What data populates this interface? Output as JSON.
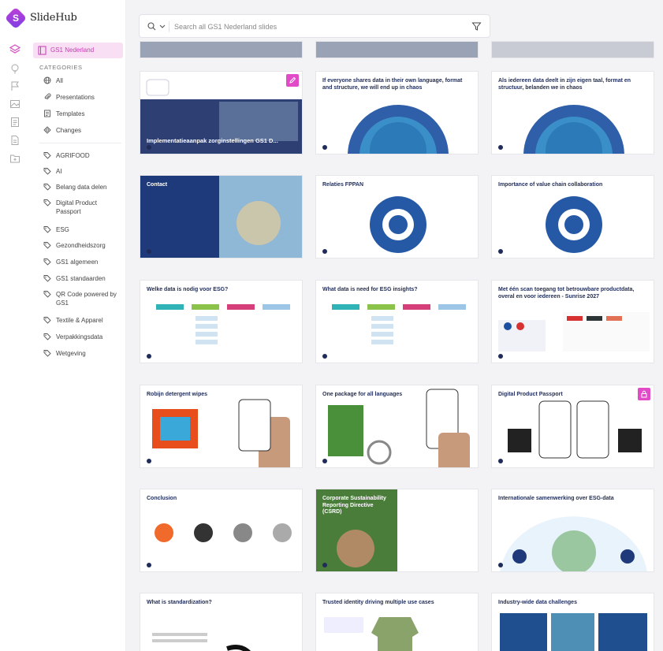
{
  "app": {
    "brand": "SlideHub"
  },
  "rail": {
    "icons": [
      "layers-icon",
      "lightbulb-icon",
      "flag-icon",
      "image-icon",
      "document-icon",
      "file-icon",
      "folder-plus-icon"
    ]
  },
  "sidebar": {
    "active_item": "GS1 Nederland",
    "categories_heading": "CATEGORIES",
    "categories": [
      {
        "label": "All",
        "icon": "globe-icon"
      },
      {
        "label": "Presentations",
        "icon": "paperclip-icon"
      },
      {
        "label": "Templates",
        "icon": "template-icon"
      },
      {
        "label": "Changes",
        "icon": "shapes-icon"
      }
    ],
    "tags": [
      "AGRIFOOD",
      "AI",
      "Belang data delen",
      "Digital Product Passport",
      "ESG",
      "Gezondheidszorg",
      "GS1 algemeen",
      "GS1 standaarden",
      "QR Code powered by GS1",
      "Textile & Apparel",
      "Verpakkingsdata",
      "Wetgeving"
    ]
  },
  "search": {
    "placeholder": "Search all GS1 Nederland slides"
  },
  "slides": [
    {
      "title": "Implementatieaanpak zorginstellingen GS1 D...",
      "badge": "edit-icon"
    },
    {
      "title": "If everyone shares data in their own language, format and structure, we will end up in chaos"
    },
    {
      "title": "Als iedereen data deelt in zijn eigen taal, format en structuur, belanden we in chaos"
    },
    {
      "title": "Contact"
    },
    {
      "title": "Relaties FPPAN"
    },
    {
      "title": "Importance of value chain collaboration"
    },
    {
      "title": "Welke data is nodig voor ESG?"
    },
    {
      "title": "What data is need for ESG insights?"
    },
    {
      "title": "Met één scan toegang tot betrouwbare productdata, overal en voor iedereen - Sunrise 2027"
    },
    {
      "title": "Robijn detergent wipes"
    },
    {
      "title": "One package for all languages"
    },
    {
      "title": "Digital Product Passport",
      "badge": "lock-icon"
    },
    {
      "title": "Conclusion"
    },
    {
      "title": "Corporate Sustainability Reporting Directive (CSRD)"
    },
    {
      "title": "Internationale samenwerking over ESG-data"
    },
    {
      "title": "What is standardization?"
    },
    {
      "title": "Trusted identity driving multiple use cases"
    },
    {
      "title": "Industry-wide data challenges"
    }
  ],
  "colors": {
    "accent": "#e14bc8",
    "navy": "#1f2c59",
    "teal": "#2fb3b6"
  }
}
